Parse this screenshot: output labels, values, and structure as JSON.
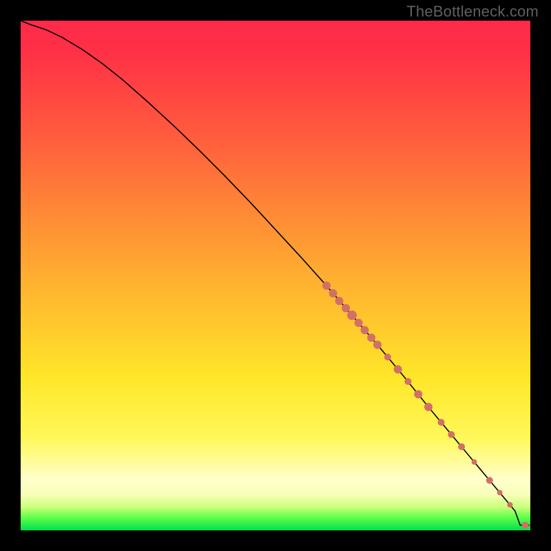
{
  "watermark": "TheBottleneck.com",
  "chart_data": {
    "type": "line",
    "title": "",
    "xlabel": "",
    "ylabel": "",
    "xlim": [
      0,
      100
    ],
    "ylim": [
      0,
      100
    ],
    "grid": false,
    "series": [
      {
        "name": "bottleneck-curve",
        "x": [
          0,
          2,
          5,
          8,
          12,
          16,
          20,
          25,
          30,
          35,
          40,
          45,
          50,
          55,
          60,
          65,
          70,
          75,
          80,
          82,
          84,
          86,
          88,
          90,
          92,
          94,
          95,
          96,
          97,
          97.5,
          98,
          100
        ],
        "y": [
          100,
          99.2,
          98.2,
          96.8,
          94.4,
          91.6,
          88.4,
          84.0,
          79.4,
          74.6,
          69.6,
          64.4,
          59.0,
          53.6,
          48.0,
          42.2,
          36.4,
          30.4,
          24.2,
          21.8,
          19.4,
          17.0,
          14.6,
          12.2,
          9.8,
          7.4,
          6.2,
          5.0,
          3.8,
          2.4,
          1.0,
          1.0
        ]
      }
    ],
    "points": [
      {
        "x": 60.0,
        "y": 48.0,
        "r": 6
      },
      {
        "x": 61.3,
        "y": 46.5,
        "r": 6
      },
      {
        "x": 62.5,
        "y": 45.0,
        "r": 6
      },
      {
        "x": 63.8,
        "y": 43.6,
        "r": 6
      },
      {
        "x": 65.0,
        "y": 42.2,
        "r": 7
      },
      {
        "x": 66.3,
        "y": 40.7,
        "r": 6
      },
      {
        "x": 67.5,
        "y": 39.3,
        "r": 6
      },
      {
        "x": 68.8,
        "y": 37.8,
        "r": 6
      },
      {
        "x": 70.0,
        "y": 36.4,
        "r": 6
      },
      {
        "x": 72.0,
        "y": 34.0,
        "r": 5
      },
      {
        "x": 74.0,
        "y": 31.6,
        "r": 6
      },
      {
        "x": 76.0,
        "y": 29.2,
        "r": 5
      },
      {
        "x": 78.0,
        "y": 26.7,
        "r": 6
      },
      {
        "x": 80.0,
        "y": 24.2,
        "r": 6
      },
      {
        "x": 82.5,
        "y": 21.2,
        "r": 5
      },
      {
        "x": 84.5,
        "y": 18.8,
        "r": 5
      },
      {
        "x": 86.5,
        "y": 16.4,
        "r": 5
      },
      {
        "x": 89.0,
        "y": 13.4,
        "r": 4
      },
      {
        "x": 92.0,
        "y": 9.8,
        "r": 5
      },
      {
        "x": 94.0,
        "y": 7.4,
        "r": 4
      },
      {
        "x": 96.0,
        "y": 5.0,
        "r": 4
      },
      {
        "x": 99.0,
        "y": 1.0,
        "r": 5
      },
      {
        "x": 100.5,
        "y": 1.0,
        "r": 5
      }
    ],
    "gradient_stops": [
      {
        "pos": 0.0,
        "color": "#ff2a4a"
      },
      {
        "pos": 0.22,
        "color": "#ff5a3e"
      },
      {
        "pos": 0.54,
        "color": "#ffb92f"
      },
      {
        "pos": 0.82,
        "color": "#fff85a"
      },
      {
        "pos": 0.93,
        "color": "#f8ffb8"
      },
      {
        "pos": 1.0,
        "color": "#00e050"
      }
    ]
  }
}
